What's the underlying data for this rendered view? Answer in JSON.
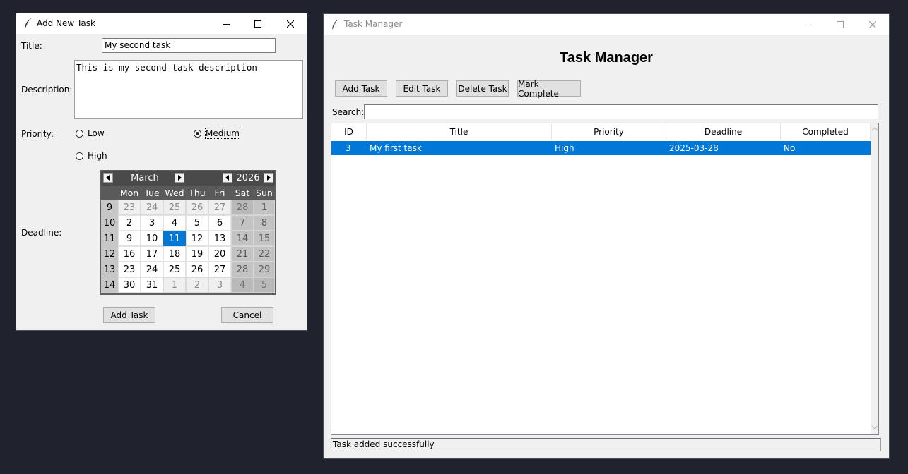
{
  "dialog": {
    "title": "Add New Task",
    "title_label": "Title:",
    "title_value": "My second task",
    "description_label": "Description:",
    "description_value": "This is my second task description",
    "priority_label": "Priority:",
    "priority_options": [
      "Low",
      "Medium",
      "High"
    ],
    "priority_selected": "Medium",
    "deadline_label": "Deadline:",
    "calendar": {
      "month": "March",
      "year": "2026",
      "weekdays": [
        "Mon",
        "Tue",
        "Wed",
        "Thu",
        "Fri",
        "Sat",
        "Sun"
      ],
      "weeks": [
        {
          "num": "9",
          "days": [
            "23",
            "24",
            "25",
            "26",
            "27",
            "28",
            "1"
          ]
        },
        {
          "num": "10",
          "days": [
            "2",
            "3",
            "4",
            "5",
            "6",
            "7",
            "8"
          ]
        },
        {
          "num": "11",
          "days": [
            "9",
            "10",
            "11",
            "12",
            "13",
            "14",
            "15"
          ]
        },
        {
          "num": "12",
          "days": [
            "16",
            "17",
            "18",
            "19",
            "20",
            "21",
            "22"
          ]
        },
        {
          "num": "13",
          "days": [
            "23",
            "24",
            "25",
            "26",
            "27",
            "28",
            "29"
          ]
        },
        {
          "num": "14",
          "days": [
            "30",
            "31",
            "1",
            "2",
            "3",
            "4",
            "5"
          ]
        }
      ],
      "selected_day": "11"
    },
    "add_button": "Add Task",
    "cancel_button": "Cancel"
  },
  "main": {
    "title": "Task Manager",
    "heading": "Task Manager",
    "toolbar": {
      "add": "Add Task",
      "edit": "Edit Task",
      "delete": "Delete Task",
      "complete": "Mark Complete"
    },
    "search_label": "Search:",
    "search_value": "",
    "columns": [
      "ID",
      "Title",
      "Priority",
      "Deadline",
      "Completed"
    ],
    "rows": [
      {
        "id": "3",
        "title": "My first task",
        "priority": "High",
        "deadline": "2025-03-28",
        "completed": "No"
      }
    ],
    "status": "Task added successfully"
  },
  "colors": {
    "selection": "#0078d7",
    "desktop": "#20222e"
  },
  "icons": [
    "feather-icon",
    "minimize-icon",
    "maximize-icon",
    "close-icon",
    "arrow-left-icon",
    "arrow-right-icon",
    "scroll-up-icon",
    "scroll-down-icon"
  ]
}
